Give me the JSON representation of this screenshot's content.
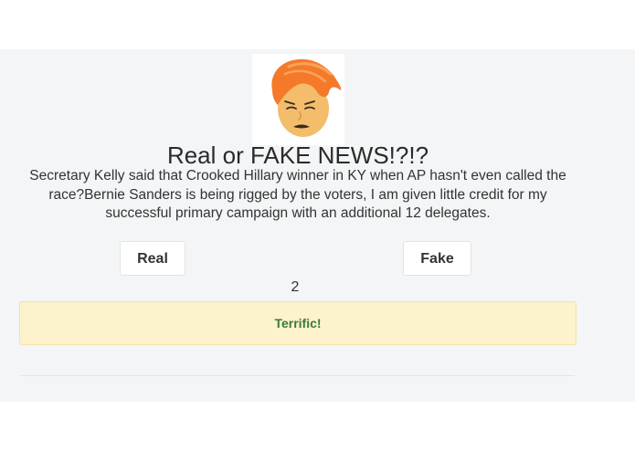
{
  "header": {
    "title": "Real or FAKE NEWS!?!?"
  },
  "statement": {
    "text": "Secretary Kelly said that Crooked Hillary winner in KY when AP hasn't even called the race?Bernie Sanders is being rigged by the voters, I am given little credit for my successful primary campaign with an additional 12 delegates."
  },
  "buttons": {
    "real_label": "Real",
    "fake_label": "Fake"
  },
  "score": {
    "value": "2"
  },
  "feedback": {
    "message": "Terrific!"
  },
  "colors": {
    "panel_bg": "#f3f5f6",
    "alert_bg": "#fcf2cb",
    "alert_text": "#3c7a3a",
    "hair": "#f47a2a",
    "face": "#f3bd6c"
  },
  "icons": {
    "avatar": "cartoon-face-with-orange-hair-icon"
  }
}
